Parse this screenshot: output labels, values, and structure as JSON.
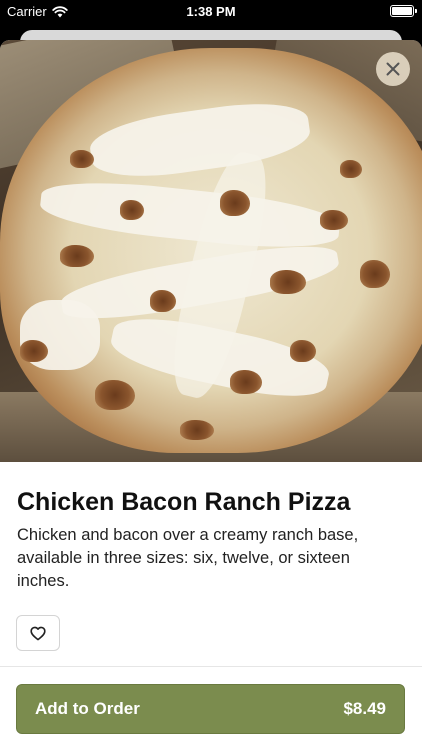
{
  "status_bar": {
    "carrier": "Carrier",
    "time": "1:38 PM"
  },
  "item": {
    "title": "Chicken Bacon Ranch Pizza",
    "description": "Chicken and bacon over a creamy ranch base, available in three sizes: six, twelve, or sixteen inches."
  },
  "actions": {
    "close_icon": "close-icon",
    "favorite_icon": "heart-outline-icon",
    "add_to_order_label": "Add to Order",
    "price": "$8.49"
  },
  "colors": {
    "accent": "#7b8c4e",
    "background": "#ffffff"
  }
}
